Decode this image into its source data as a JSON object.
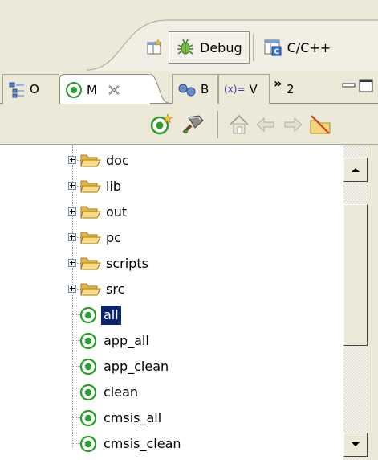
{
  "perspective_bar": {
    "open_perspective_icon": "open-perspective-icon",
    "items": [
      {
        "label": "Debug",
        "icon": "debug-bug-icon",
        "active": true
      },
      {
        "label": "C/C++",
        "icon": "cpp-perspective-icon",
        "active": false
      }
    ]
  },
  "view_tabs": {
    "tabs": [
      {
        "label": "O",
        "icon": "outline-icon",
        "active": false
      },
      {
        "label": "M",
        "icon": "make-target-icon",
        "active": true,
        "closable": true
      },
      {
        "label": "B",
        "icon": "breakpoints-icon",
        "active": false
      },
      {
        "label": "V",
        "icon": "variables-icon",
        "icon_text": "(x)=",
        "active": false
      }
    ],
    "overflow_chevron": "»",
    "overflow_count": "2"
  },
  "local_toolbar": {
    "buttons": [
      "new-make-target-icon",
      "build-target-icon",
      "home-icon",
      "back-icon",
      "forward-icon",
      "filter-icon"
    ]
  },
  "tree": {
    "folders": [
      "doc",
      "lib",
      "out",
      "pc",
      "scripts",
      "src"
    ],
    "targets": [
      "all",
      "app_all",
      "app_clean",
      "clean",
      "cmsis_all",
      "cmsis_clean"
    ],
    "selected": "all"
  },
  "colors": {
    "chrome": "#ece9d8",
    "selection": "#0a246a",
    "target_green": "#2e9b2e",
    "folder": "#f3cf5b"
  }
}
